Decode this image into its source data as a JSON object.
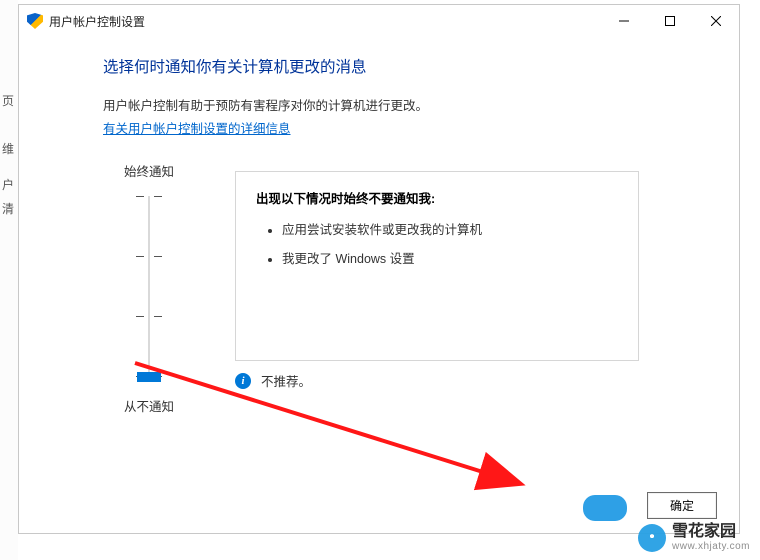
{
  "bg_left": {
    "a": "页",
    "b": "维",
    "c": "户",
    "d": "清"
  },
  "window": {
    "title": "用户帐户控制设置",
    "heading": "选择何时通知你有关计算机更改的消息",
    "description": "用户帐户控制有助于预防有害程序对你的计算机进行更改。",
    "link": "有关用户帐户控制设置的详细信息",
    "slider": {
      "top_label": "始终通知",
      "bottom_label": "从不通知"
    },
    "panel": {
      "title": "出现以下情况时始终不要通知我:",
      "items": [
        "应用尝试安装软件或更改我的计算机",
        "我更改了 Windows 设置"
      ]
    },
    "recommendation": "不推荐。",
    "ok_button": "确定"
  },
  "watermark": {
    "cn": "雪花家园",
    "url": "www.xhjaty.com"
  }
}
